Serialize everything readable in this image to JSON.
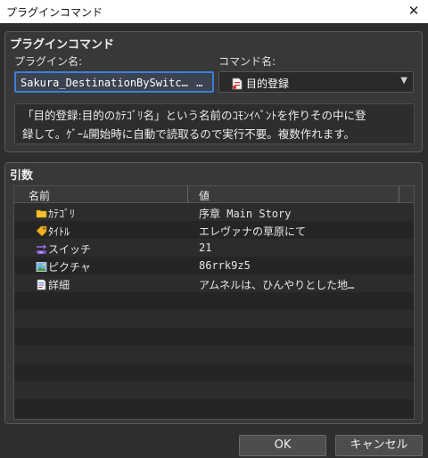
{
  "window": {
    "title": "プラグインコマンド",
    "close_glyph": "✕"
  },
  "section1": {
    "title": "プラグインコマンド",
    "plugin_label": "プラグイン名:",
    "plugin_value": "Sakura_DestinationBySwitc…",
    "plugin_button": "…",
    "command_label": "コマンド名:",
    "command_value": "目的登録",
    "command_icon": "document-icon",
    "description_line1": "「目的登録:目的のｶﾃｺﾞﾘ名」という名前のｺﾓﾝｲﾍﾞﾝﾄを作りその中に登",
    "description_line2": "録して。ｹﾞｰﾑ開始時に自動で読取るので実行不要。複数作れます。"
  },
  "section2": {
    "title": "引数",
    "columns": [
      "名前",
      "値"
    ],
    "rows": [
      {
        "name": "ｶﾃｺﾞﾘ",
        "value": "序章 Main Story",
        "icon": "folder-icon"
      },
      {
        "name": "ﾀｲﾄﾙ",
        "value": "エレヴァナの草原にて",
        "icon": "tag-icon"
      },
      {
        "name": "スイッチ",
        "value": "21",
        "icon": "switch-icon"
      },
      {
        "name": "ピクチャ",
        "value": "86rrk9z5",
        "icon": "picture-icon"
      },
      {
        "name": "詳細",
        "value": "アムネルは、ひんやりとした地…",
        "icon": "note-icon"
      }
    ],
    "empty_rows": 7
  },
  "buttons": {
    "ok": "OK",
    "cancel": "キャンセル"
  }
}
